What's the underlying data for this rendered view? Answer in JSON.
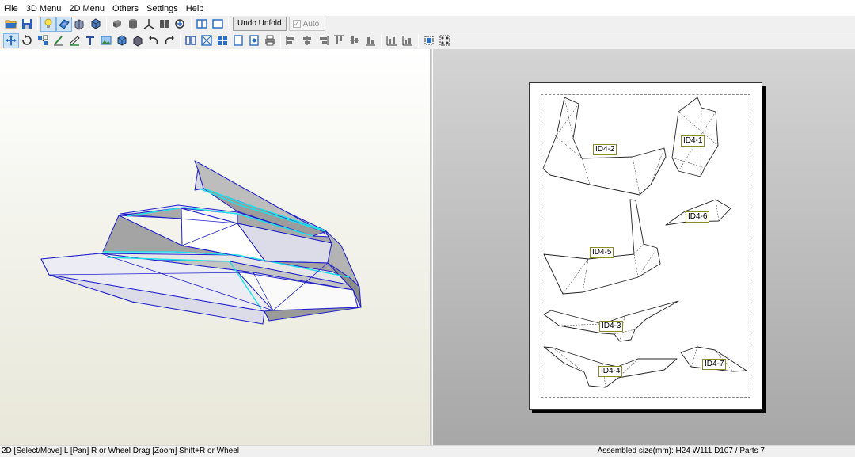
{
  "menu": {
    "items": [
      "File",
      "3D Menu",
      "2D Menu",
      "Others",
      "Settings",
      "Help"
    ]
  },
  "toolbar1": {
    "icons": [
      "open-folder-icon",
      "save-disk-icon",
      "lightbulb-icon",
      "texture-icon",
      "parts-icon",
      "rotate-parts-icon",
      "cylinder-icon",
      "cup-icon",
      "axes-icon",
      "join-faces-icon",
      "view-link-icon",
      "split-view-icon",
      "window-icon"
    ],
    "undo_unfold_label": "Undo Unfold",
    "auto_label": "Auto",
    "auto_checked": true
  },
  "toolbar2": {
    "icons": [
      "select-move-icon",
      "rotate-icon",
      "join-icon",
      "edge-edit-icon",
      "flap-icon",
      "text-icon",
      "image-icon",
      "box-icon",
      "parts-3d-icon",
      "undo-icon",
      "redo-icon",
      "book-icon",
      "zoom-fit-icon",
      "grid-pages-icon",
      "page-icon",
      "page-setup-icon",
      "print-icon",
      "align-left-icon",
      "align-center-h-icon",
      "align-right-icon",
      "align-top-icon",
      "align-middle-v-icon",
      "align-bottom-icon",
      "distribute-h-icon",
      "distribute-v-icon",
      "group-icon",
      "ungroup-icon"
    ]
  },
  "pane2d": {
    "parts": [
      "ID4-2",
      "ID4-1",
      "ID4-6",
      "ID4-5",
      "ID4-3",
      "ID4-4",
      "ID4-7"
    ]
  },
  "status": {
    "left": "2D [Select/Move] L [Pan] R or Wheel Drag [Zoom] Shift+R or Wheel",
    "right": "Assembled size(mm): H24 W111 D107 / Parts 7"
  },
  "colors": {
    "model_edge": "#2020c8",
    "highlight_edge": "#22e0e8",
    "paper_bg": "#ffffff",
    "label_border": "#8a8a2a"
  }
}
